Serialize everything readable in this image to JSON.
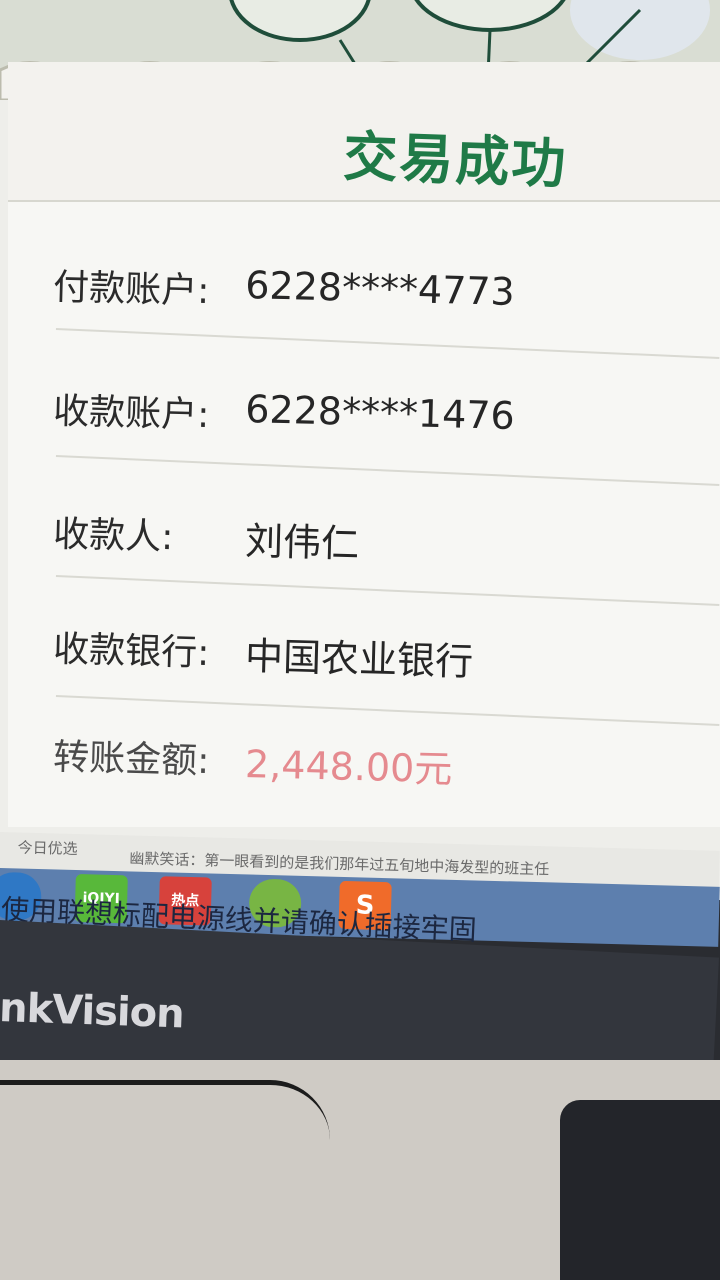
{
  "receipt": {
    "title": "交易成功",
    "rows": [
      {
        "label": "付款账户:",
        "value": "6228****4773"
      },
      {
        "label": "收款账户:",
        "value": "6228****1476"
      },
      {
        "label": "收款人:",
        "value": "刘伟仁"
      },
      {
        "label": "收款银行:",
        "value": "中国农业银行"
      },
      {
        "label": "转账金额:",
        "value": "2,448.00元"
      }
    ]
  },
  "browser": {
    "news_tag": "今日优选",
    "news_headline": "幽默笑话：第一眼看到的是我们那年过五旬地中海发型的班主任"
  },
  "taskbar": {
    "iqiyi_label": "iQIYI",
    "hot_label": "热点",
    "sogou_label": "S"
  },
  "monitor": {
    "overlay_message": "使用联想标配电源线并请确认插接牢固",
    "brand": "nkVision"
  },
  "colors": {
    "title_green": "#1f7a47",
    "amount_pink": "#e58a8f"
  }
}
